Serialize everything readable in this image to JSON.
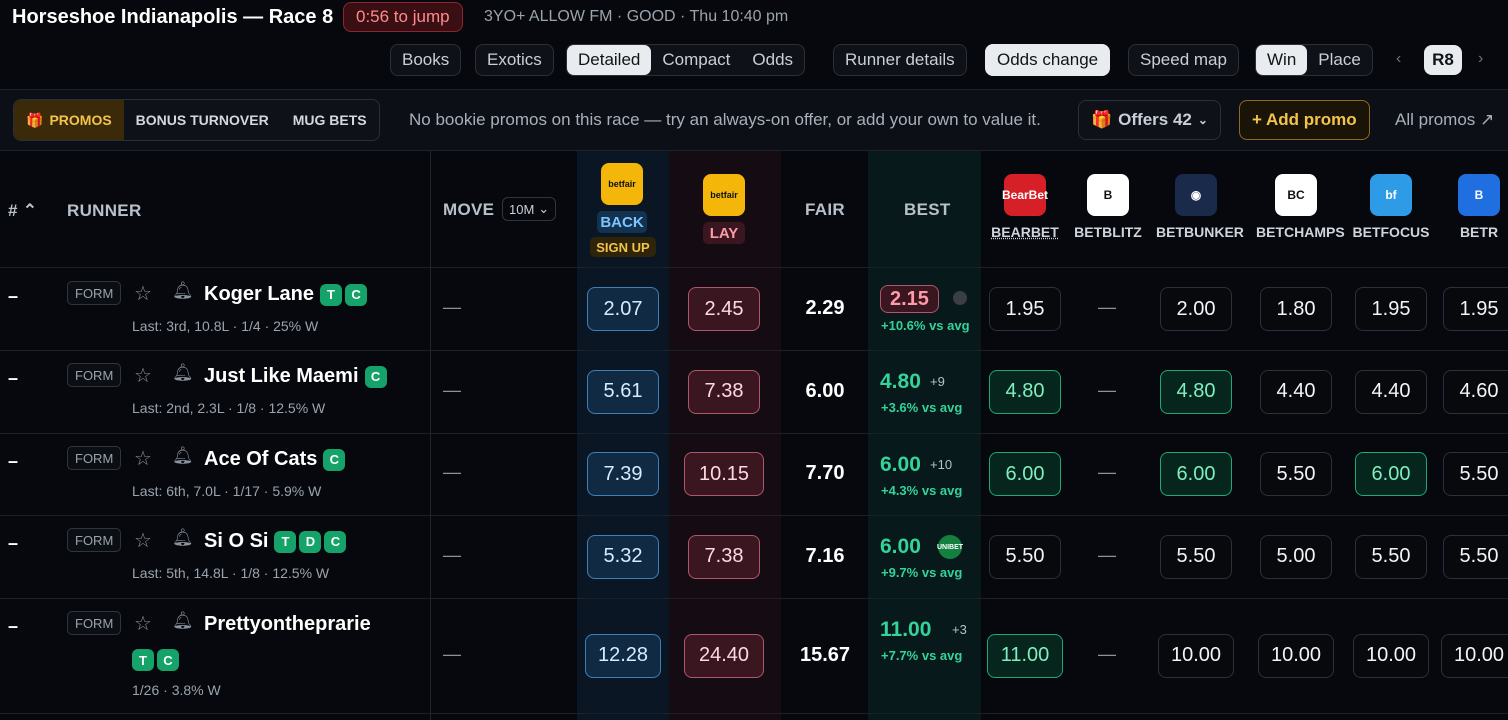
{
  "header": {
    "title": "Horseshoe Indianapolis — Race 8",
    "jump": "0:56 to jump",
    "meta": "3YO+ ALLOW FM · GOOD · Thu 10:40 pm"
  },
  "toolbar": {
    "books": "Books",
    "exotics": "Exotics",
    "detailed": "Detailed",
    "compact": "Compact",
    "odds": "Odds",
    "runner_details": "Runner details",
    "odds_change": "Odds change",
    "speed_map": "Speed map",
    "win": "Win",
    "place": "Place",
    "race": "R8"
  },
  "promos": {
    "promos": "PROMOS",
    "bonus": "BONUS TURNOVER",
    "mug": "MUG BETS",
    "message": "No bookie promos on this race — try an always-on offer, or add your own to value it.",
    "offers": "Offers 42",
    "add": "+ Add promo",
    "all": "All promos"
  },
  "columns": {
    "num": "#",
    "runner": "RUNNER",
    "move": "MOVE",
    "move_window": "10M",
    "back": "BACK",
    "signup": "SIGN UP",
    "lay": "LAY",
    "fair": "FAIR",
    "best": "BEST"
  },
  "books": [
    {
      "name": "BEARBET",
      "logo": "BearBet",
      "color": "#d61f26"
    },
    {
      "name": "BETBLITZ",
      "logo": "B",
      "color": "#ffffff"
    },
    {
      "name": "BETBUNKER",
      "logo": "◉",
      "color": "#1a2a4a"
    },
    {
      "name": "BETCHAMPS",
      "logo": "BC",
      "color": "#ffffff"
    },
    {
      "name": "BETFOCUS",
      "logo": "bf",
      "color": "#2e9be6"
    },
    {
      "name": "BETR",
      "logo": "B",
      "color": "#1f6fe0"
    }
  ],
  "runners": [
    {
      "num": "–",
      "form": "FORM",
      "name": "Koger Lane",
      "tags": [
        "T",
        "C"
      ],
      "sub": "Last: 3rd, 10.8L · 1/4 · 25% W",
      "move": "—",
      "back": "2.07",
      "lay": "2.45",
      "fair": "2.29",
      "best": "2.15",
      "best_note": "",
      "best_sub": "+10.6% vs avg",
      "books": [
        "1.95",
        "—",
        "2.00",
        "1.80",
        "1.95",
        "1.95"
      ],
      "green": []
    },
    {
      "num": "–",
      "form": "FORM",
      "name": "Just Like Maemi",
      "tags": [
        "C"
      ],
      "sub": "Last: 2nd, 2.3L · 1/8 · 12.5% W",
      "move": "—",
      "back": "5.61",
      "lay": "7.38",
      "fair": "6.00",
      "best": "4.80",
      "best_note": "+9",
      "best_sub": "+3.6% vs avg",
      "books": [
        "4.80",
        "—",
        "4.80",
        "4.40",
        "4.40",
        "4.60"
      ],
      "green": [
        0,
        2
      ]
    },
    {
      "num": "–",
      "form": "FORM",
      "name": "Ace Of Cats",
      "tags": [
        "C"
      ],
      "sub": "Last: 6th, 7.0L · 1/17 · 5.9% W",
      "move": "—",
      "back": "7.39",
      "lay": "10.15",
      "fair": "7.70",
      "best": "6.00",
      "best_note": "+10",
      "best_sub": "+4.3% vs avg",
      "books": [
        "6.00",
        "—",
        "6.00",
        "5.50",
        "6.00",
        "5.50"
      ],
      "green": [
        0,
        2,
        4
      ]
    },
    {
      "num": "–",
      "form": "FORM",
      "name": "Si O Si",
      "tags": [
        "T",
        "D",
        "C"
      ],
      "sub": "Last: 5th, 14.8L · 1/8 · 12.5% W",
      "move": "—",
      "back": "5.32",
      "lay": "7.38",
      "fair": "7.16",
      "best": "6.00",
      "best_note": "UNIBET",
      "best_sub": "+9.7% vs avg",
      "books": [
        "5.50",
        "—",
        "5.50",
        "5.00",
        "5.50",
        "5.50"
      ],
      "green": []
    },
    {
      "num": "–",
      "form": "FORM",
      "name": "Prettyontheprarie",
      "tags": [
        "T",
        "C"
      ],
      "sub": "1/26 · 3.8% W",
      "move": "—",
      "back": "12.28",
      "lay": "24.40",
      "fair": "15.67",
      "best": "11.00",
      "best_note": "+3",
      "best_sub": "+7.7% vs avg",
      "books": [
        "11.00",
        "—",
        "10.00",
        "10.00",
        "10.00",
        "10.00"
      ],
      "green": [
        0
      ]
    }
  ]
}
